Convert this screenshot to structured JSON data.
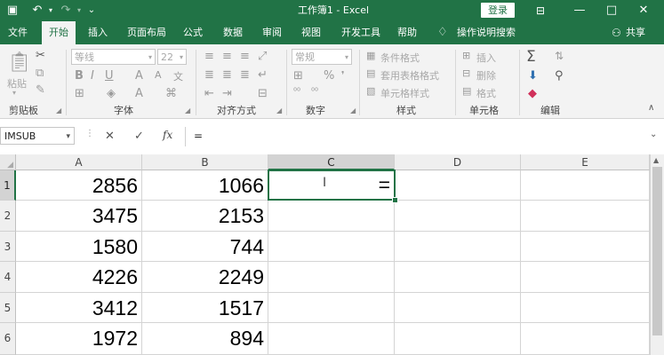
{
  "titlebar": {
    "title": "工作簿1 - Excel",
    "login": "登录",
    "save_icon": "save-icon",
    "undo_icon": "undo-icon",
    "redo_icon": "redo-icon",
    "min_icon": "minimize-icon",
    "max_icon": "maximize-icon",
    "close_icon": "close-icon"
  },
  "tabs": [
    "文件",
    "开始",
    "插入",
    "页面布局",
    "公式",
    "数据",
    "审阅",
    "视图",
    "开发工具",
    "帮助"
  ],
  "tell_me": "操作说明搜索",
  "share": "共享",
  "ribbon": {
    "clipboard": {
      "paste": "粘贴",
      "label": "剪贴板"
    },
    "font": {
      "name": "等线",
      "size": "22",
      "label": "字体"
    },
    "alignment": {
      "label": "对齐方式"
    },
    "number": {
      "format": "常规",
      "label": "数字"
    },
    "styles": {
      "cond": "条件格式",
      "table": "套用表格格式",
      "cell": "单元格样式",
      "label": "样式"
    },
    "cells": {
      "insert": "插入",
      "delete": "删除",
      "format": "格式",
      "label": "单元格"
    },
    "editing": {
      "label": "编辑"
    }
  },
  "formula_bar": {
    "name_box": "IMSUB",
    "cancel": "✕",
    "enter": "✓",
    "fx": "fx",
    "content": "="
  },
  "columns": [
    "A",
    "B",
    "C",
    "D",
    "E"
  ],
  "rows": [
    {
      "n": "1",
      "a": "2856",
      "b": "1066",
      "c": "="
    },
    {
      "n": "2",
      "a": "3475",
      "b": "2153",
      "c": ""
    },
    {
      "n": "3",
      "a": "1580",
      "b": "744",
      "c": ""
    },
    {
      "n": "4",
      "a": "4226",
      "b": "2249",
      "c": ""
    },
    {
      "n": "5",
      "a": "3412",
      "b": "1517",
      "c": ""
    },
    {
      "n": "6",
      "a": "1972",
      "b": "894",
      "c": ""
    }
  ],
  "colors": {
    "accent": "#217346",
    "active_border": "#217346"
  }
}
